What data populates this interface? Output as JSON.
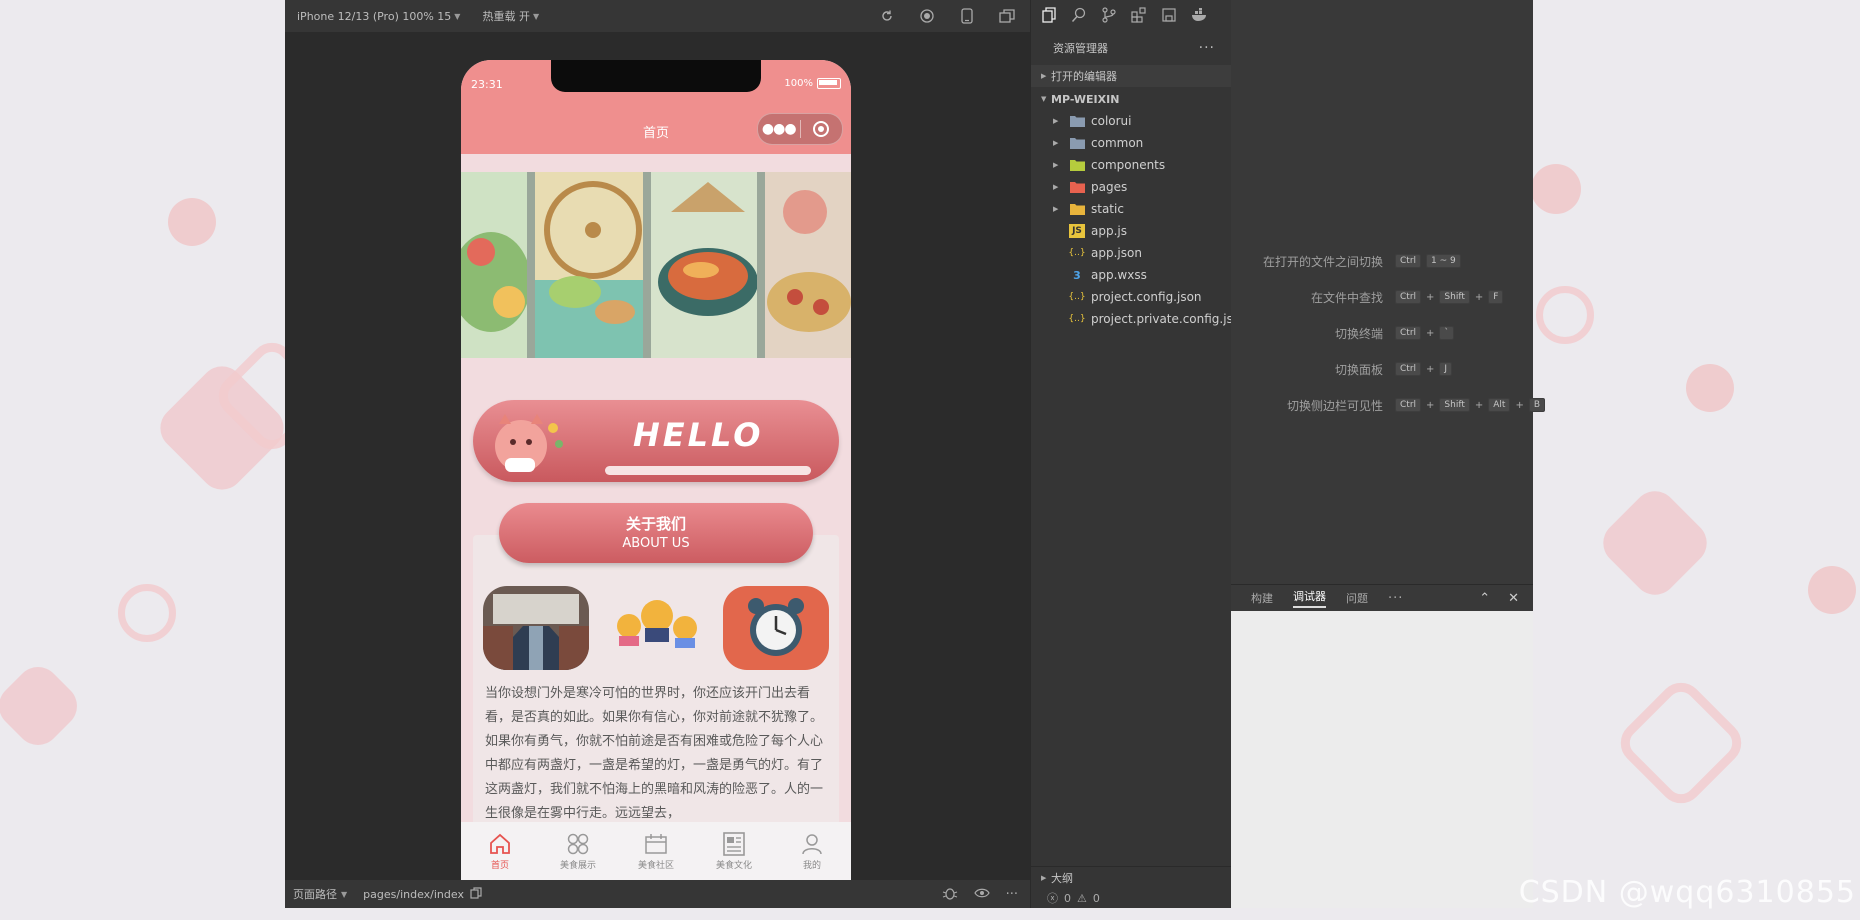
{
  "simulator": {
    "device_label": "iPhone 12/13 (Pro) 100% 15",
    "hot_reload_label": "热重载 开",
    "path_label": "页面路径",
    "path_value": "pages/index/index"
  },
  "phone": {
    "time": "23:31",
    "battery": "100%",
    "nav_title": "首页",
    "hello_text": "HELLO",
    "about_cn": "关于我们",
    "about_en": "ABOUT US",
    "paragraph": "当你设想门外是寒冷可怕的世界时，你还应该开门出去看看，是否真的如此。如果你有信心，你对前途就不犹豫了。如果你有勇气，你就不怕前途是否有困难或危险了每个人心中都应有两盏灯，一盏是希望的灯，一盏是勇气的灯。有了这两盏灯，我们就不怕海上的黑暗和风涛的险恶了。人的一生很像是在雾中行走。远远望去，",
    "tabs": [
      {
        "label": "首页",
        "icon": "home-icon",
        "active": true
      },
      {
        "label": "美食展示",
        "icon": "grid-icon",
        "active": false
      },
      {
        "label": "美食社区",
        "icon": "calendar-icon",
        "active": false
      },
      {
        "label": "美食文化",
        "icon": "news-icon",
        "active": false
      },
      {
        "label": "我的",
        "icon": "user-icon",
        "active": false
      }
    ]
  },
  "explorer": {
    "title": "资源管理器",
    "open_editors": "打开的编辑器",
    "project": "MP-WEIXIN",
    "folders": [
      "colorui",
      "common",
      "components",
      "pages",
      "static"
    ],
    "files": [
      "app.js",
      "app.json",
      "app.wxss",
      "project.config.json",
      "project.private.config.js..."
    ],
    "outline": "大纲",
    "errors": "0",
    "warnings": "0"
  },
  "shortcuts": [
    {
      "label": "在打开的文件之间切换",
      "keys": [
        "Ctrl",
        "1 ~ 9"
      ]
    },
    {
      "label": "在文件中查找",
      "keys": [
        "Ctrl",
        "+",
        "Shift",
        "+",
        "F"
      ]
    },
    {
      "label": "切换终端",
      "keys": [
        "Ctrl",
        "+",
        "`"
      ]
    },
    {
      "label": "切换面板",
      "keys": [
        "Ctrl",
        "+",
        "J"
      ]
    },
    {
      "label": "切换侧边栏可见性",
      "keys": [
        "Ctrl",
        "+",
        "Shift",
        "+",
        "Alt",
        "+",
        "B"
      ]
    }
  ],
  "debug_panel": {
    "tabs": [
      "构建",
      "调试器",
      "问题"
    ],
    "active_tab": "调试器"
  },
  "watermark": "CSDN @wqq6310855",
  "colors": {
    "accent": "#ef8f8e",
    "tab_active": "#e6534f"
  }
}
